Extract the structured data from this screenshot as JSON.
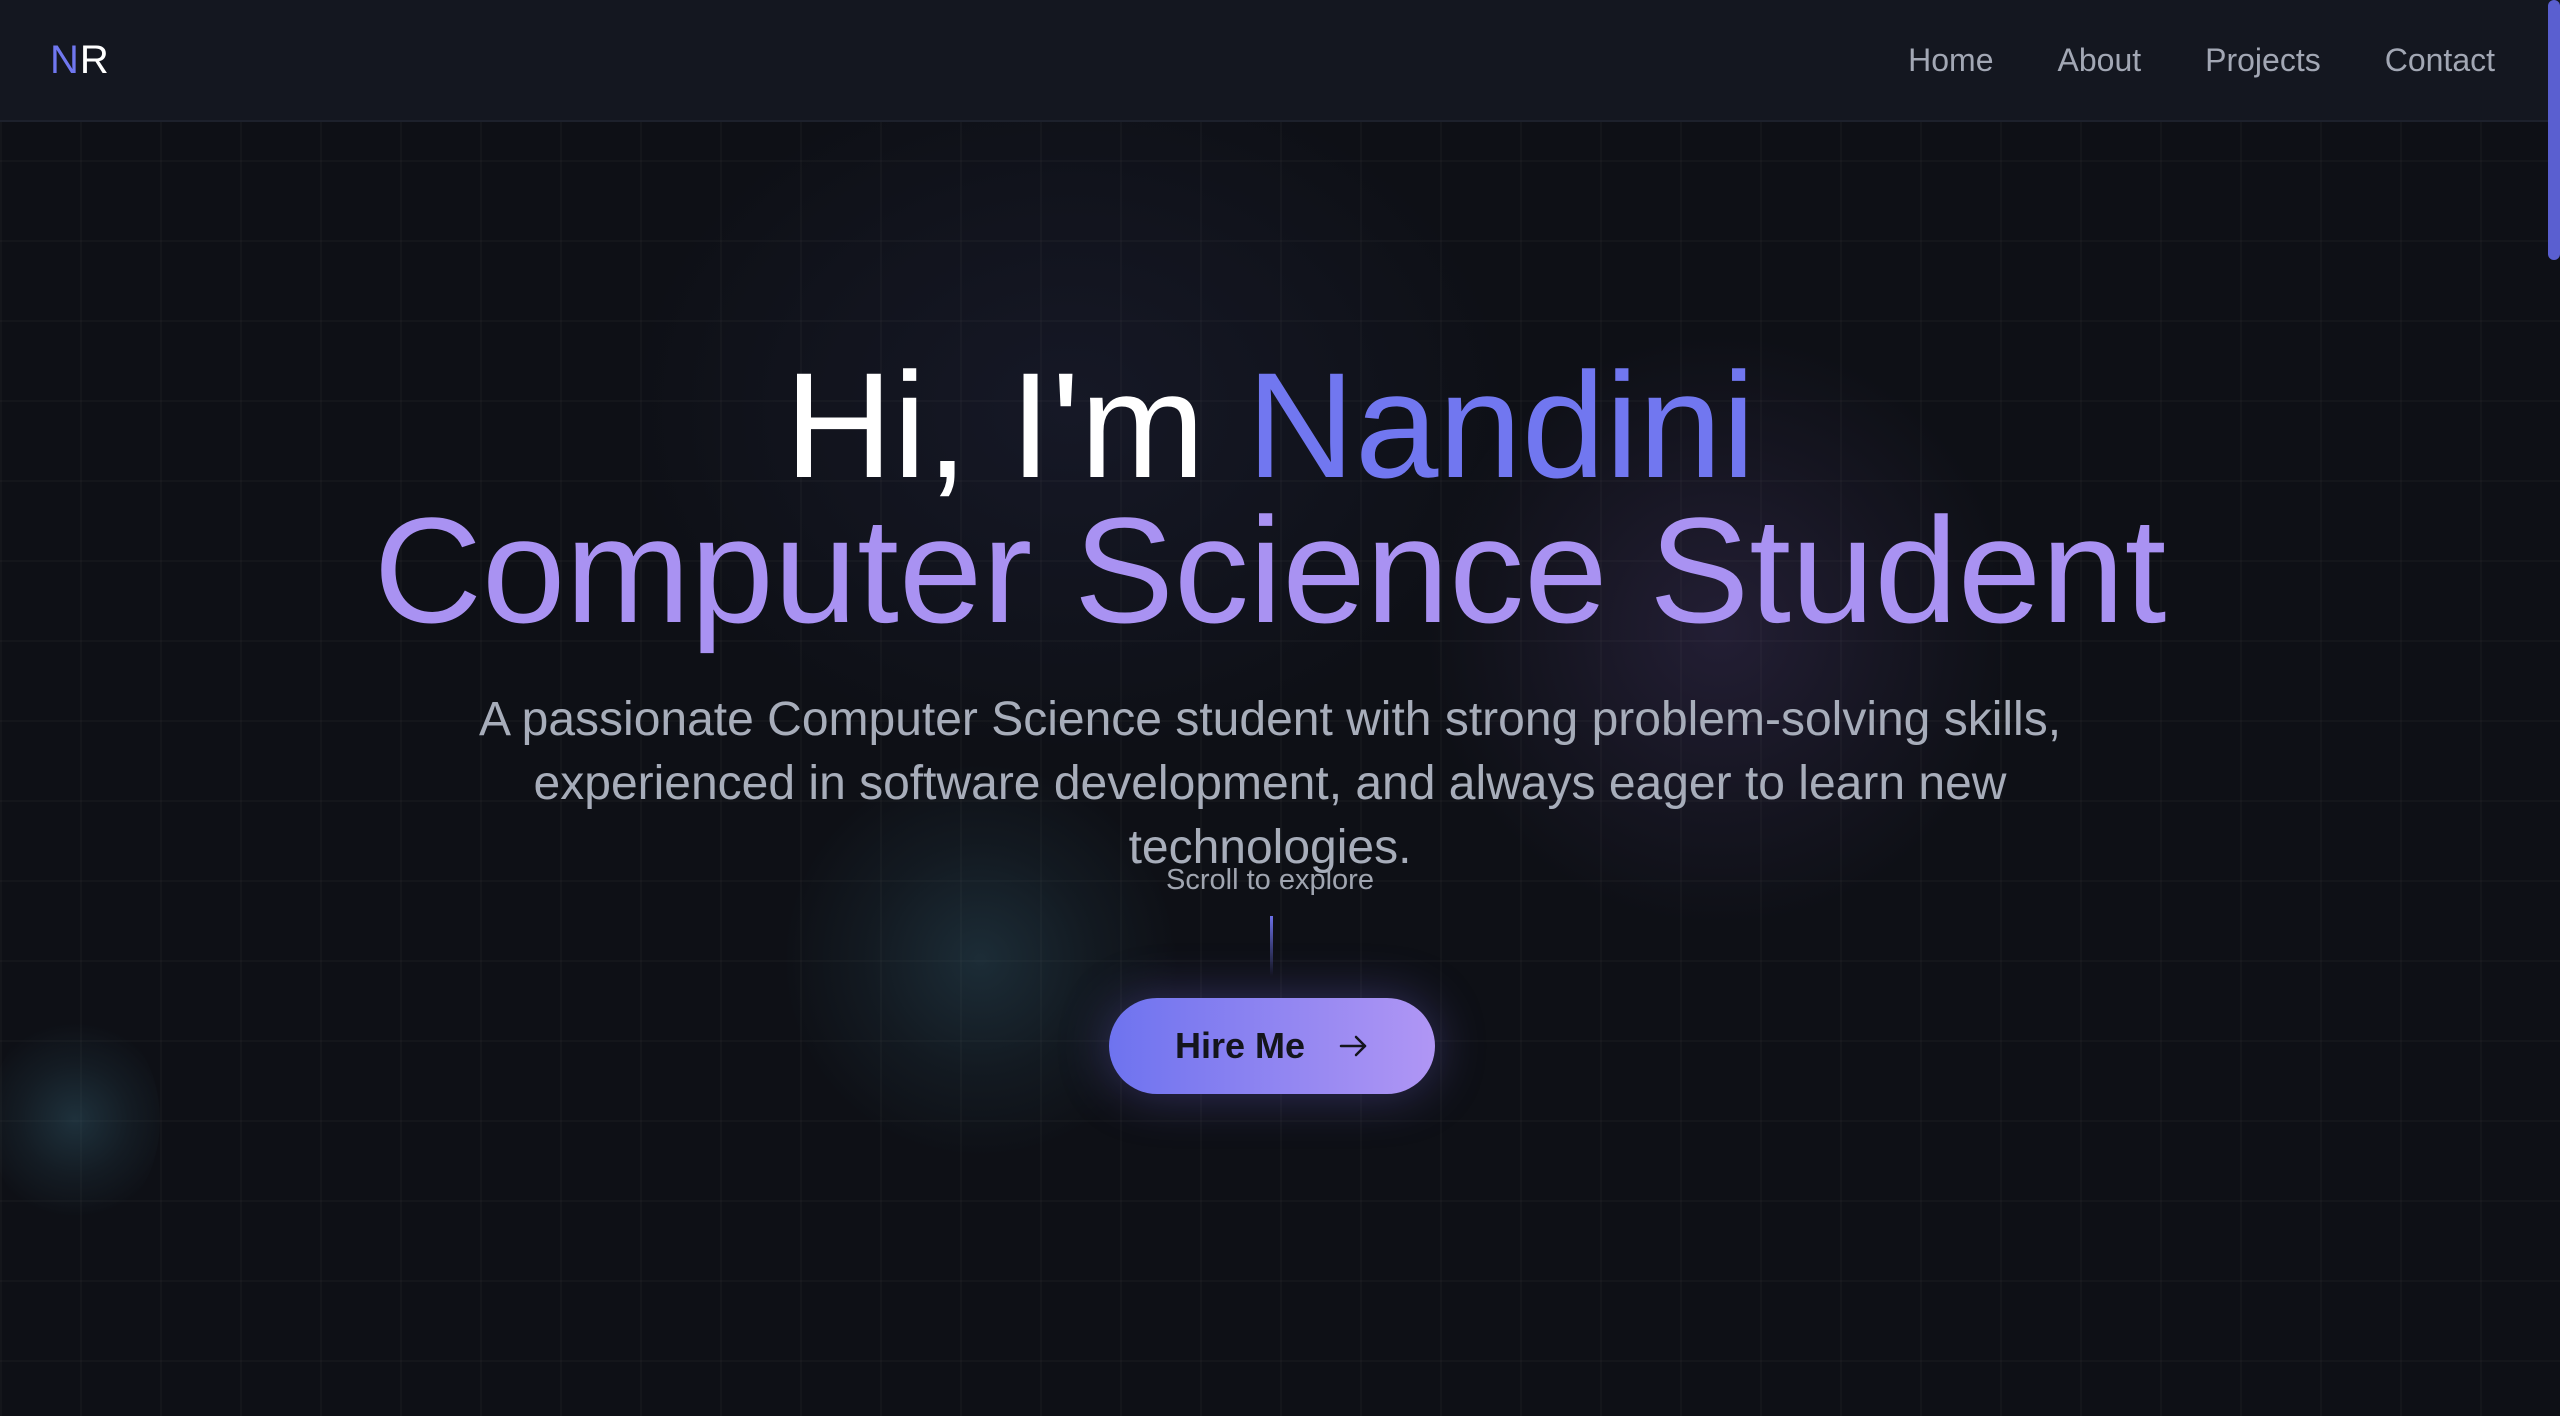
{
  "navbar": {
    "logo_first": "N",
    "logo_second": "R",
    "links": [
      "Home",
      "About",
      "Projects",
      "Contact"
    ]
  },
  "hero": {
    "greeting": "Hi, I'm",
    "name": "Nandini",
    "role": "Computer Science Student",
    "description": "A passionate Computer Science student with strong problem-solving skills, experienced in software development, and always eager to learn new technologies.",
    "scroll_hint": "Scroll to explore",
    "cta_label": "Hire Me",
    "cta_icon": "arrow-right-icon"
  },
  "colors": {
    "background": "#0e1016",
    "navbar": "#141720",
    "accent_indigo": "#7177f0",
    "accent_purple": "#a992f2",
    "text_muted": "#a7adba"
  }
}
